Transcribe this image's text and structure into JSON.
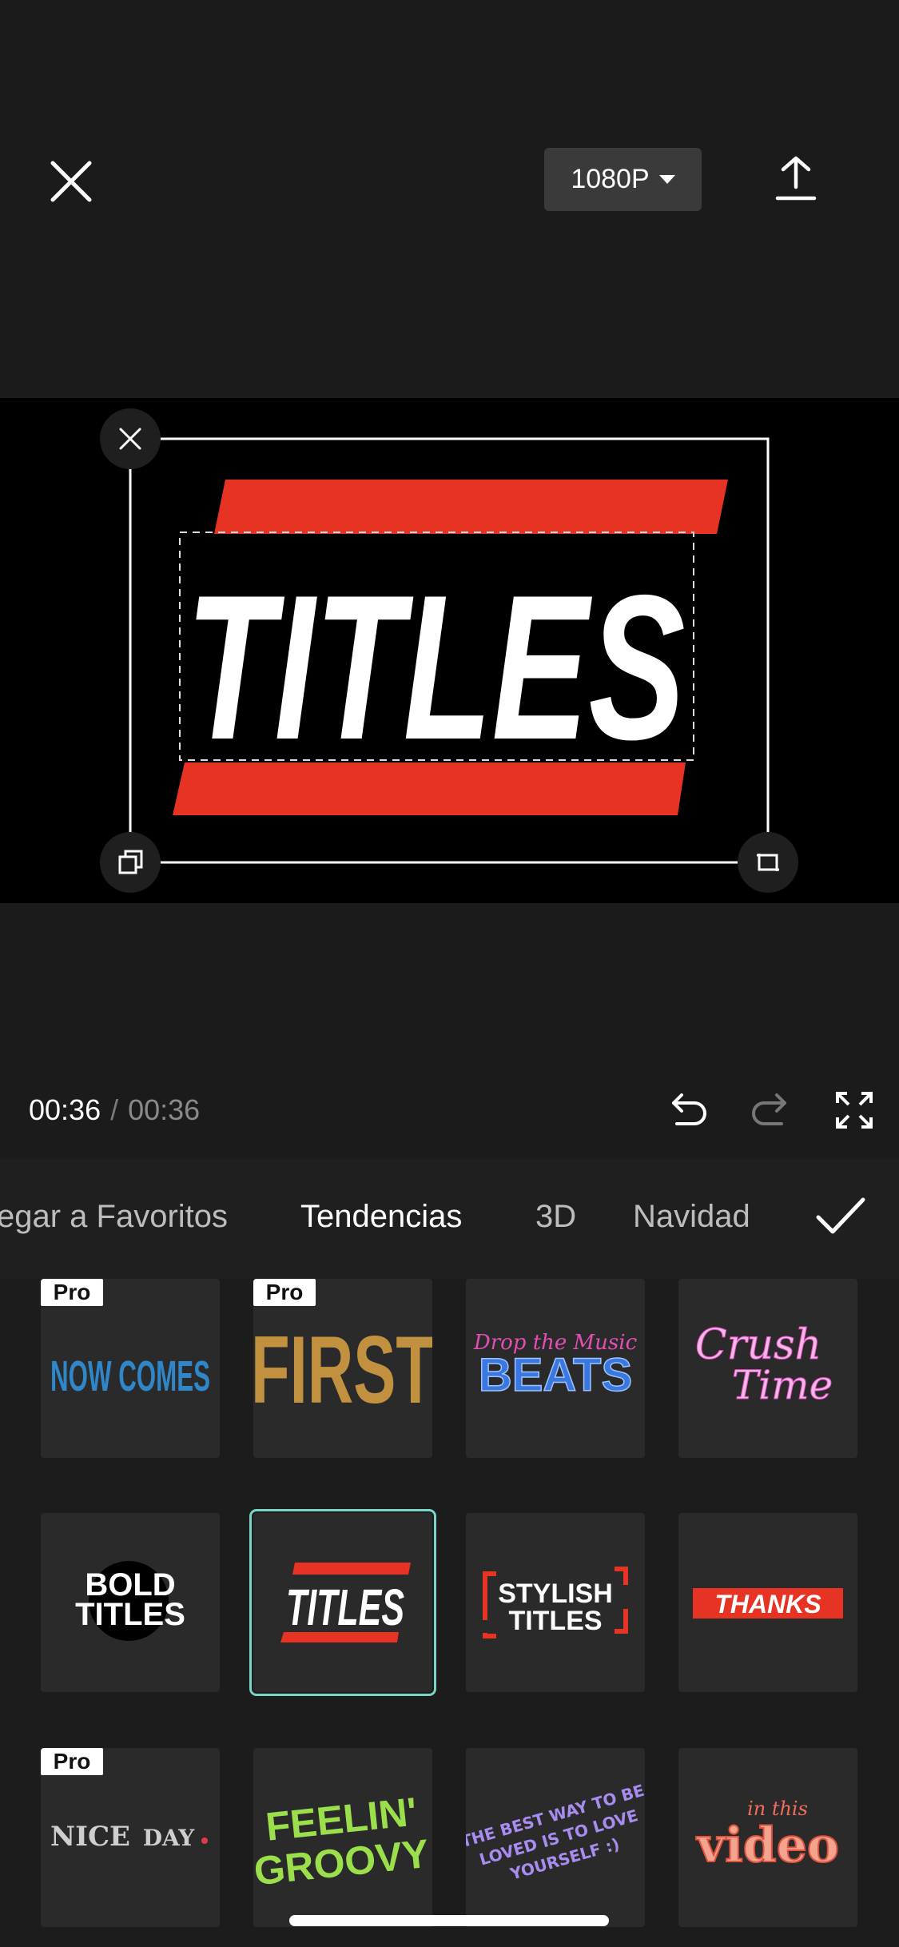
{
  "header": {
    "resolution_label": "1080P"
  },
  "preview": {
    "title_text": "TITLES"
  },
  "playback": {
    "current_time": "00:36",
    "separator": "/",
    "total_time": "00:36"
  },
  "categories": [
    {
      "label": "egar a Favoritos"
    },
    {
      "label": "Tendencias"
    },
    {
      "label": "3D"
    },
    {
      "label": "Navidad"
    }
  ],
  "templates": [
    {
      "name": "NOW COMES",
      "pro": "Pro"
    },
    {
      "name": "FIRST",
      "pro": "Pro"
    },
    {
      "line1": "Drop the Music",
      "line2": "BEATS"
    },
    {
      "line1": "Crush",
      "line2": "Time"
    },
    {
      "line1": "BOLD",
      "line2": "TITLES"
    },
    {
      "line1": "TITLES"
    },
    {
      "line1": "STYLISH",
      "line2": "TITLES"
    },
    {
      "line1": "THANKS"
    },
    {
      "line1": "NICE",
      "line2": "DAY",
      "pro": "Pro"
    },
    {
      "line1": "FEELIN'",
      "line2": "GROOVY"
    },
    {
      "line1": "THE BEST WAY TO BE",
      "line2": "LOVED IS TO LOVE",
      "line3": "YOURSELF :)"
    },
    {
      "line1": "in this",
      "line2": "video"
    }
  ],
  "colors": {
    "accent_red": "#e63323",
    "selected_outline": "#7ad4c8",
    "background": "#1c1c1c"
  }
}
